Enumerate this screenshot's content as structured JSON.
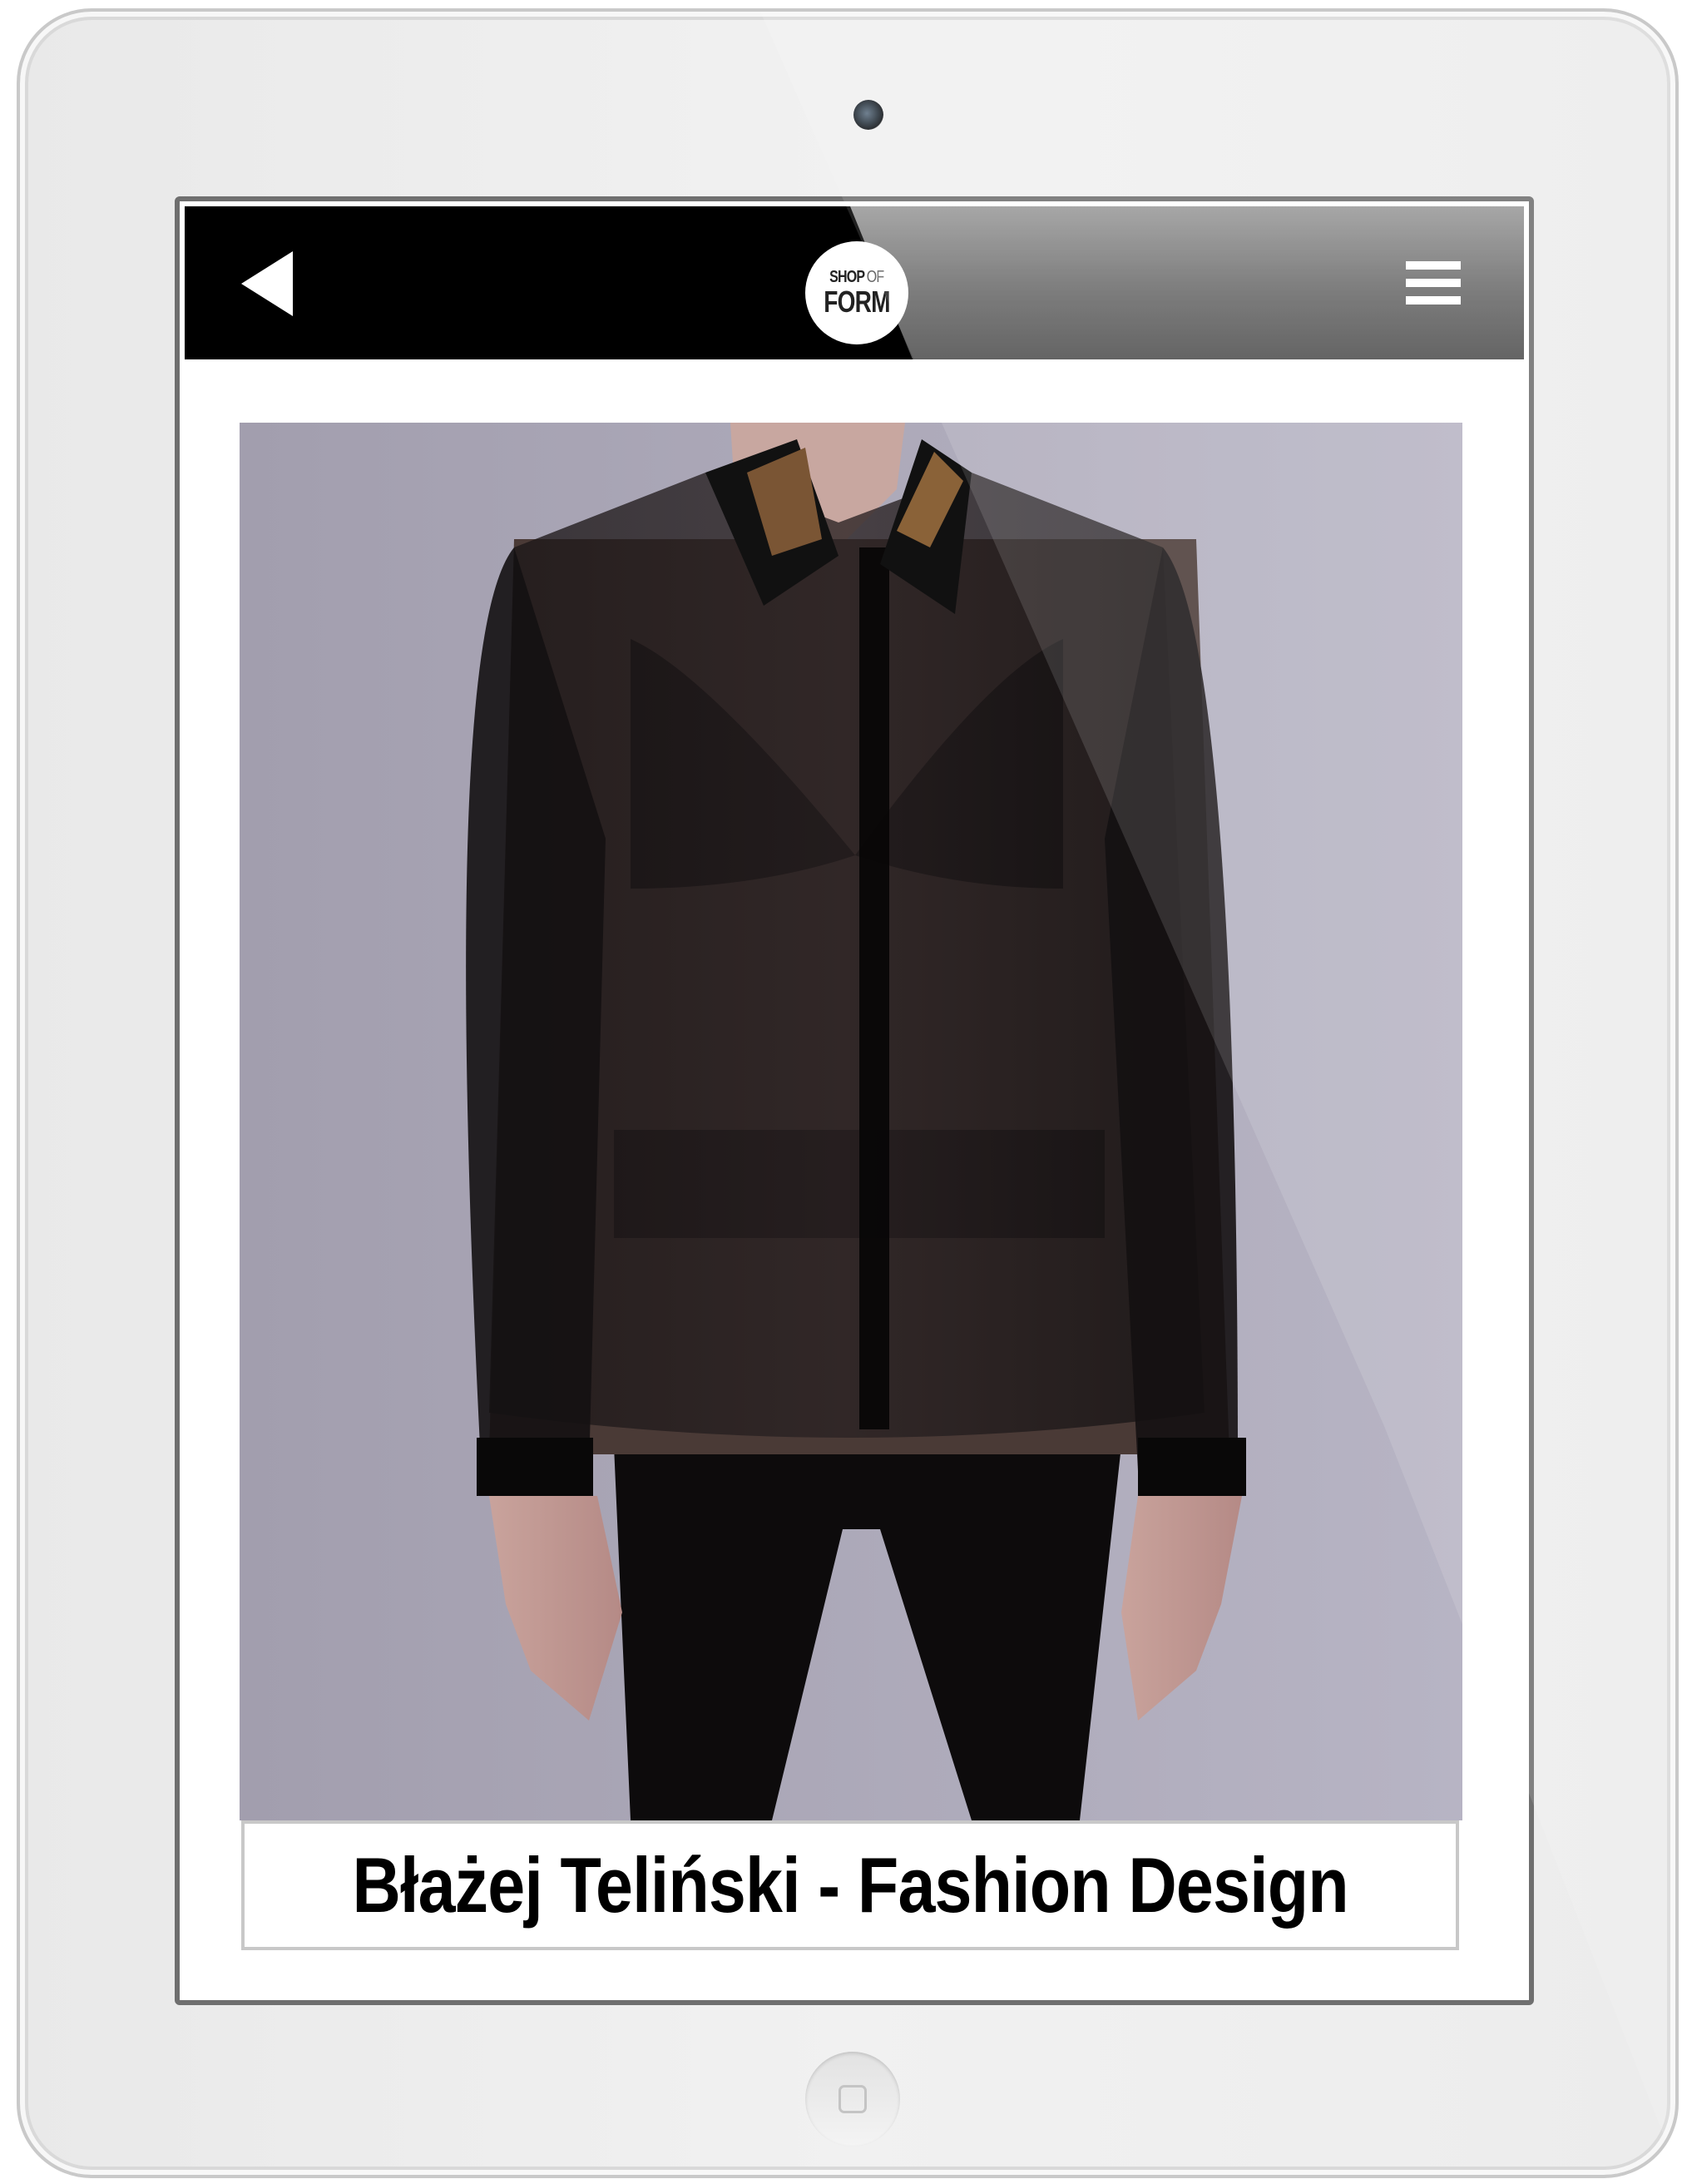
{
  "device": {
    "type": "tablet"
  },
  "header": {
    "back_icon": "back-arrow-icon",
    "logo": {
      "line1_bold": "SHOP",
      "line1_light": "OF",
      "line2": "FORM"
    },
    "menu_icon": "hamburger-menu-icon",
    "colors": {
      "left": "#000000",
      "right": "#6a6a6a"
    }
  },
  "product": {
    "image_icon": "product-photo",
    "caption": "Błażej Teliński - Fashion Design"
  },
  "home": {
    "icon": "home-button-icon"
  }
}
